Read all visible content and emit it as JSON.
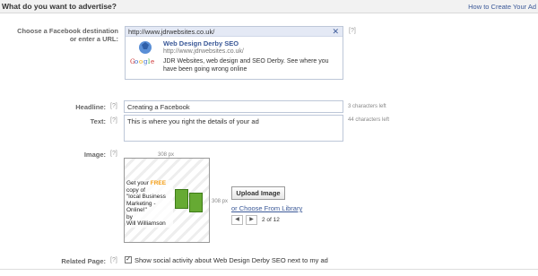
{
  "header": {
    "title": "What do you want to advertise?",
    "help_link": "How to Create Your Ad"
  },
  "destination": {
    "label_line1": "Choose a Facebook destination",
    "label_line2": "or enter a URL:",
    "help": "[?]",
    "url_value": "http://www.jdrwebsites.co.uk/",
    "clear_icon": "close-icon",
    "preview": {
      "logo_alt": "Google",
      "title": "Web Design Derby SEO",
      "url": "http://www.jdrwebsites.co.uk/",
      "description": "JDR Websites, web design and SEO Derby. See where you have been going wrong online"
    }
  },
  "headline": {
    "label": "Headline:",
    "help": "[?]",
    "value": "Creating a Facebook",
    "remaining": "3 characters left"
  },
  "text": {
    "label": "Text:",
    "help": "[?]",
    "value": "This is where you right the details of your ad",
    "remaining": "44 characters left"
  },
  "image": {
    "label": "Image:",
    "help": "[?]",
    "width_note": "308 px",
    "height_note": "308 px",
    "promo_line1": "Get your ",
    "promo_free": "FREE",
    "promo_line1b": " copy of",
    "promo_line2": "\"local Business Marketing - Online!\"",
    "promo_line3": "by",
    "promo_line4": "Will Williamson",
    "upload_button": "Upload Image",
    "library_link": "or Choose From Library",
    "prev_icon": "◀",
    "next_icon": "▶",
    "counter": "2 of 12"
  },
  "related": {
    "label": "Related Page:",
    "help": "[?]",
    "checked": true,
    "text": "Show social activity about Web Design Derby SEO next to my ad"
  },
  "colors": {
    "link": "#3b5998",
    "accent": "#f39c12"
  }
}
